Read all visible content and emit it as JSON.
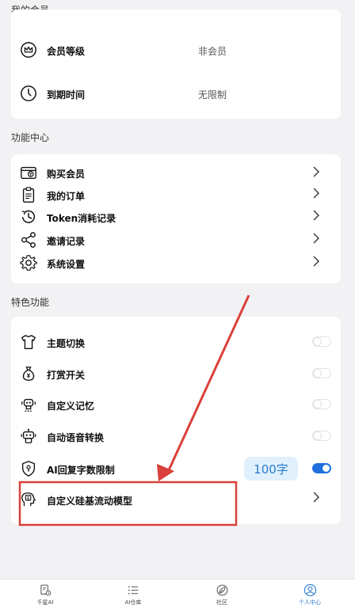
{
  "sections": {
    "membership": "我的会员",
    "functions": "功能中心",
    "features": "特色功能"
  },
  "membership": {
    "level_label": "会员等级",
    "level_value": "非会员",
    "expiry_label": "到期时间",
    "expiry_value": "无限制"
  },
  "functions": [
    {
      "label": "购买会员",
      "icon": "wallet-card-icon"
    },
    {
      "label": "我的订单",
      "icon": "clipboard-icon"
    },
    {
      "label": "Token消耗记录",
      "icon": "clock-history-icon"
    },
    {
      "label": "邀请记录",
      "icon": "share-icon"
    },
    {
      "label": "系统设置",
      "icon": "gear-icon"
    }
  ],
  "features": [
    {
      "label": "主题切换",
      "icon": "tshirt-icon",
      "toggle": false
    },
    {
      "label": "打赏开关",
      "icon": "money-bag-icon",
      "toggle": false
    },
    {
      "label": "自定义记忆",
      "icon": "robot-icon",
      "toggle": false
    },
    {
      "label": "自动语音转换",
      "icon": "robot-voice-icon",
      "toggle": false
    },
    {
      "label": "AI回复字数限制",
      "icon": "shield-icon",
      "toggle": true,
      "badge": "100字"
    },
    {
      "label": "自定义硅基流动模型",
      "icon": "brain-head-icon",
      "chevron": true
    }
  ],
  "nav": [
    {
      "label": "千星AI",
      "icon": "doc-clock-icon",
      "active": false
    },
    {
      "label": "AI仓库",
      "icon": "list-icon",
      "active": false
    },
    {
      "label": "社区",
      "icon": "leaf-icon",
      "active": false
    },
    {
      "label": "个人中心",
      "icon": "user-circle-icon",
      "active": true
    }
  ],
  "colors": {
    "accent": "#1f6fde",
    "annotation": "#d9413a",
    "badge_bg": "#e0f0fc"
  }
}
